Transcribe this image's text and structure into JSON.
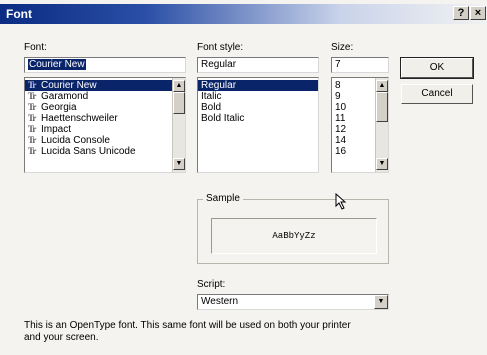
{
  "window": {
    "title": "Font",
    "help_btn": "?",
    "close_btn": "×"
  },
  "font": {
    "label": "Font:",
    "value": "Courier New",
    "items": [
      {
        "icon": "Tr",
        "name": "Courier New",
        "selected": true
      },
      {
        "icon": "Tr",
        "name": "Garamond"
      },
      {
        "icon": "Tr",
        "name": "Georgia"
      },
      {
        "icon": "Tr",
        "name": "Haettenschweiler"
      },
      {
        "icon": "Tr",
        "name": "Impact"
      },
      {
        "icon": "Tr",
        "name": "Lucida Console"
      },
      {
        "icon": "Tr",
        "name": "Lucida Sans Unicode"
      }
    ]
  },
  "style": {
    "label": "Font style:",
    "value": "Regular",
    "items": [
      "Regular",
      "Italic",
      "Bold",
      "Bold Italic"
    ]
  },
  "size": {
    "label": "Size:",
    "value": "7",
    "items": [
      "8",
      "9",
      "10",
      "11",
      "12",
      "14",
      "16"
    ]
  },
  "buttons": {
    "ok": "OK",
    "cancel": "Cancel"
  },
  "sample": {
    "label": "Sample",
    "text": "AaBbYyZz"
  },
  "script": {
    "label": "Script:",
    "value": "Western"
  },
  "scroll": {
    "up": "▲",
    "down": "▼"
  },
  "description": {
    "line1": "This is an OpenType font. This same font will be used on both your printer",
    "line2": "and your screen."
  }
}
